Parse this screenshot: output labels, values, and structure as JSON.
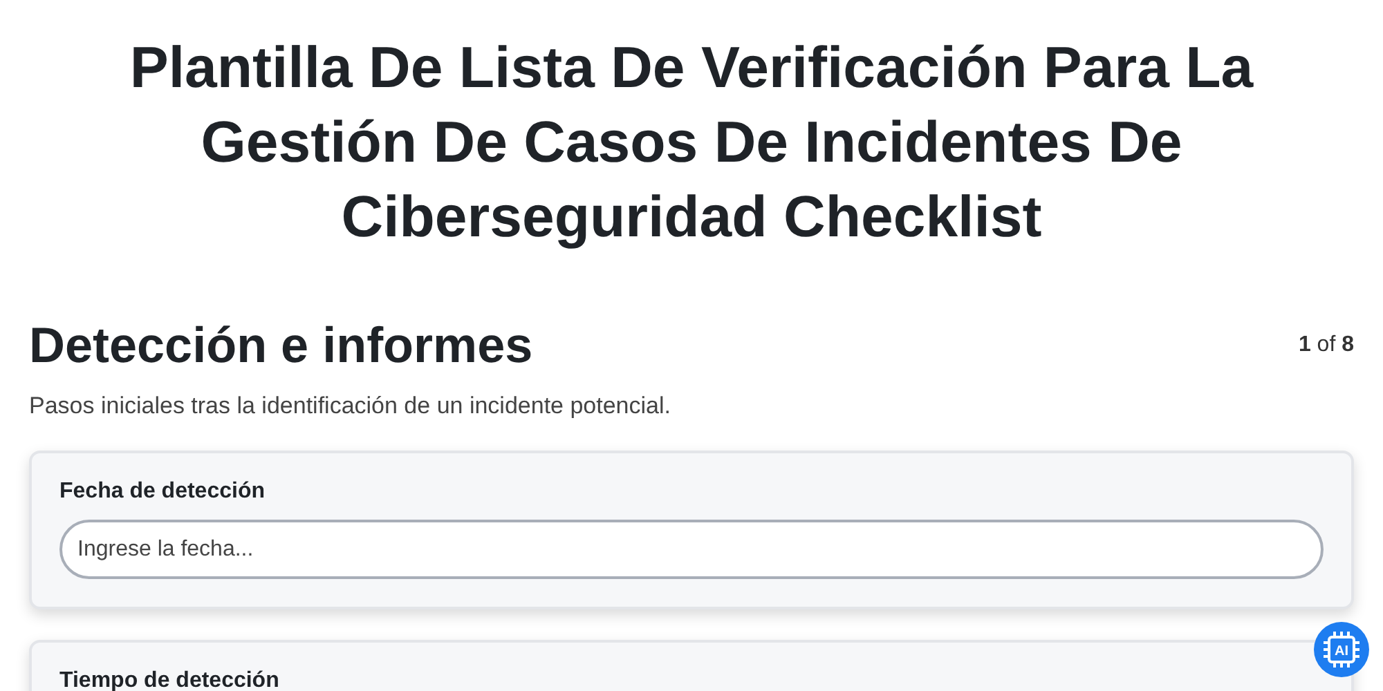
{
  "title": "Plantilla De Lista De Verificación Para La Gestión De Casos De Incidentes De Ciberseguridad Checklist",
  "section": {
    "heading": "Detección e informes",
    "counter": "**1** of **8**",
    "description": "Pasos iniciales tras la identificación de un incidente potencial."
  },
  "fields": [
    {
      "label": "Fecha de detección",
      "placeholder": "Ingrese la fecha..."
    },
    {
      "label": "Tiempo de detección"
    }
  ],
  "ai_button": {
    "label": "AI"
  }
}
